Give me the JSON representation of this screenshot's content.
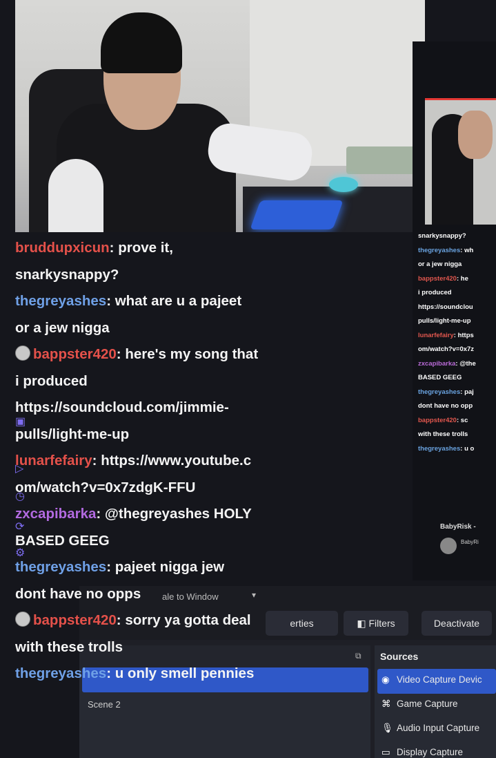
{
  "chat": {
    "messages": [
      {
        "lines": [
          {
            "user": "bruddupxicun",
            "color": "red",
            "text": "prove it,"
          },
          {
            "text": "snarkysnappy?"
          }
        ]
      },
      {
        "lines": [
          {
            "user": "thegreyashes",
            "color": "blue",
            "text": "what are u a pajeet"
          },
          {
            "text": "or a jew nigga"
          }
        ]
      },
      {
        "lines": [
          {
            "user": "bappster420",
            "color": "red",
            "badge": true,
            "text": "here's my song that"
          },
          {
            "text": "i produced"
          },
          {
            "text": "https://soundcloud.com/jimmie-"
          },
          {
            "text": "pulls/light-me-up"
          }
        ]
      },
      {
        "lines": [
          {
            "user": "lunarfefairy",
            "color": "red",
            "text": "https://www.youtube.c"
          },
          {
            "text": "om/watch?v=0x7zdgK-FFU"
          }
        ]
      },
      {
        "lines": [
          {
            "user": "zxcapibarka",
            "color": "pur",
            "text": "@thegreyashes HOLY"
          },
          {
            "text": "BASED GEEG"
          }
        ]
      },
      {
        "lines": [
          {
            "user": "thegreyashes",
            "color": "blue",
            "text": "pajeet nigga jew"
          },
          {
            "text": "dont have no opps"
          }
        ]
      },
      {
        "lines": [
          {
            "user": "bappster420",
            "color": "red",
            "badge": true,
            "text": "sorry ya gotta deal"
          },
          {
            "text": "with these trolls"
          }
        ]
      },
      {
        "lines": [
          {
            "user": "thegreyashes",
            "color": "blue",
            "text": "u only smell pennies"
          }
        ]
      }
    ]
  },
  "preview_chat": {
    "lines": [
      {
        "text": "snarkysnappy?"
      },
      {
        "user": "thegreyashes",
        "color": "blue",
        "text": "wh"
      },
      {
        "text": "or a jew nigga"
      },
      {
        "user": "bappster420",
        "color": "red",
        "text": "he"
      },
      {
        "text": "i produced"
      },
      {
        "text": "https://soundclou"
      },
      {
        "text": "pulls/light-me-up"
      },
      {
        "user": "lunarfefairy",
        "color": "red",
        "text": "https"
      },
      {
        "text": "om/watch?v=0x7z"
      },
      {
        "user": "zxcapibarka",
        "color": "pur",
        "text": "@the"
      },
      {
        "text": "BASED GEEG"
      },
      {
        "user": "thegreyashes",
        "color": "blue",
        "text": "paj"
      },
      {
        "text": "dont have no opp"
      },
      {
        "user": "bappster420",
        "color": "red",
        "text": "sc"
      },
      {
        "text": "with these trolls"
      },
      {
        "user": "thegreyashes",
        "color": "blue",
        "text": "u o"
      }
    ],
    "stream_name": "BabyRisk -",
    "stream_sub": "BabyRi"
  },
  "obs": {
    "scale_label": "ale to Window",
    "properties_label": "erties",
    "filters_label": "Filters",
    "deactivate_label": "Deactivate",
    "scenes": {
      "items": [
        "Scene 2"
      ]
    },
    "sources": {
      "title": "Sources",
      "items": [
        {
          "icon": "camera-icon",
          "glyph": "◉",
          "label": "Video Capture Devic"
        },
        {
          "icon": "gamepad-icon",
          "glyph": "⌘",
          "label": "Game Capture"
        },
        {
          "icon": "microphone-icon",
          "glyph": "🎙",
          "label": "Audio Input Capture"
        },
        {
          "icon": "monitor-icon",
          "glyph": "▭",
          "label": "Display Capture"
        }
      ]
    }
  }
}
